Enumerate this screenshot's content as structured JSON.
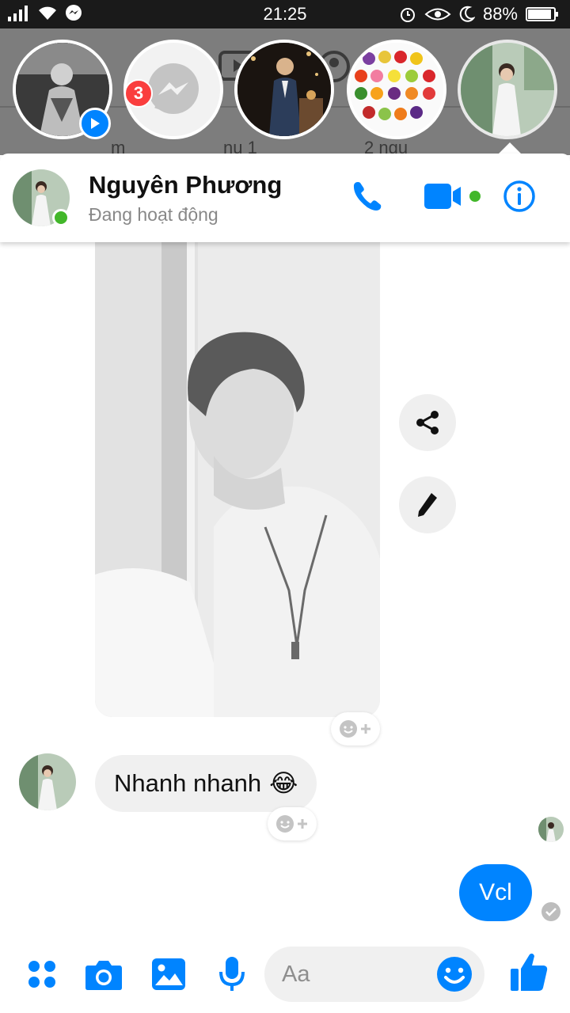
{
  "status_bar": {
    "time": "21:25",
    "battery": "88%"
  },
  "background_strip": {
    "partial_text_left": "m",
    "partial_text_mid": "nu 1",
    "partial_text_right": "2 ngu"
  },
  "chat_heads": {
    "badge_count": "3"
  },
  "header": {
    "name": "Nguyên Phương",
    "status": "Đang hoạt động"
  },
  "messages": [
    {
      "from": "them",
      "type": "image"
    },
    {
      "from": "them",
      "type": "text",
      "text": "Nhanh nhanh",
      "emoji": "😂"
    },
    {
      "from": "me",
      "type": "text",
      "text": "Vcl"
    }
  ],
  "composer": {
    "placeholder": "Aa"
  },
  "colors": {
    "accent": "#0084ff",
    "online": "#42b72a",
    "badge": "#fa3e3e"
  }
}
